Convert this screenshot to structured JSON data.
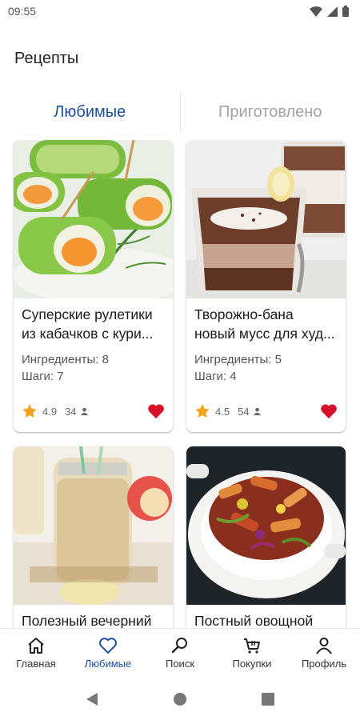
{
  "status": {
    "time": "09:55"
  },
  "header": {
    "title": "Рецепты"
  },
  "tabs": [
    {
      "label": "Любимые",
      "active": true
    },
    {
      "label": "Приготовлено",
      "active": false
    }
  ],
  "recipes": [
    {
      "title_line1": "Суперские рулетики",
      "title_line2": "из кабачков с кури...",
      "ingredients": "Ингредиенты: 8",
      "steps": "Шаги: 7",
      "rating": "4.9",
      "count": "34",
      "favorite": true
    },
    {
      "title_line1": "Творожно-бана",
      "title_line2": "новый мусс для худ...",
      "ingredients": "Ингредиенты: 5",
      "steps": "Шаги: 4",
      "rating": "4.5",
      "count": "54",
      "favorite": true
    },
    {
      "title_line1": "Полезный вечерний"
    },
    {
      "title_line1": "Постный овощной"
    }
  ],
  "bottom_nav": [
    {
      "label": "Главная",
      "icon": "home-icon"
    },
    {
      "label": "Любимые",
      "icon": "heart-outline-icon",
      "active": true
    },
    {
      "label": "Поиск",
      "icon": "search-icon"
    },
    {
      "label": "Покупки",
      "icon": "cart-icon"
    },
    {
      "label": "Профиль",
      "icon": "profile-icon"
    }
  ],
  "colors": {
    "accent": "#1d4f9e",
    "heart": "#d8112b",
    "star": "#f2a21d"
  }
}
